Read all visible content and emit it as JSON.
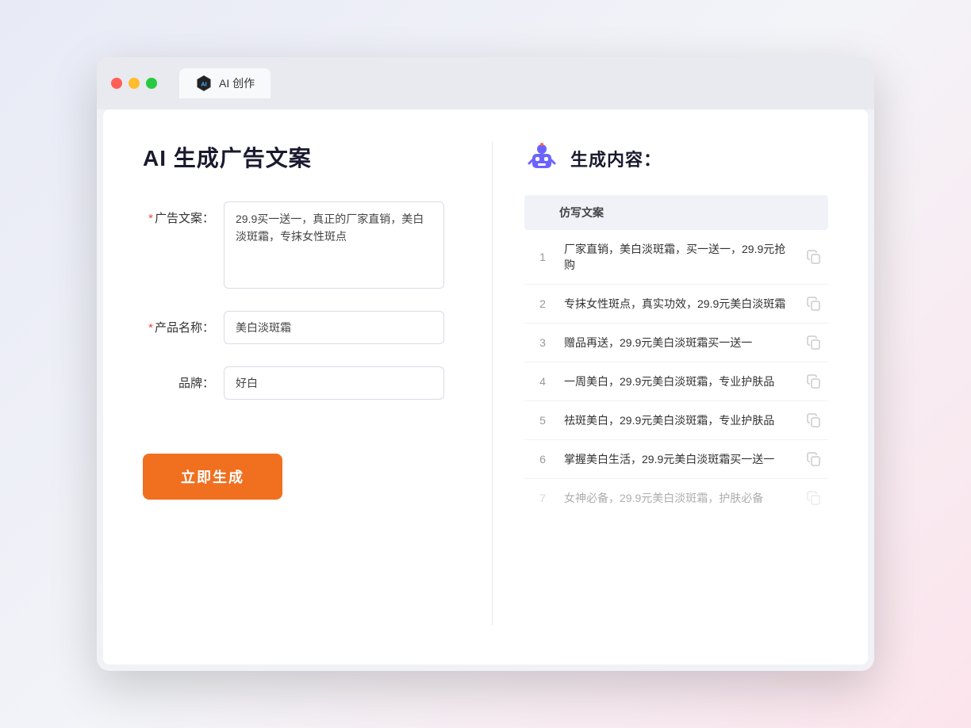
{
  "browser": {
    "tab_title": "AI 创作"
  },
  "page": {
    "title": "AI 生成广告文案",
    "result_title": "生成内容："
  },
  "form": {
    "ad_copy_label": "广告文案：",
    "ad_copy_required": "*",
    "ad_copy_value": "29.9买一送一，真正的厂家直销，美白淡斑霜，专抹女性斑点",
    "product_name_label": "产品名称：",
    "product_name_required": "*",
    "product_name_value": "美白淡斑霜",
    "brand_label": "品牌：",
    "brand_value": "好白",
    "generate_button": "立即生成"
  },
  "results": {
    "column_header": "仿写文案",
    "items": [
      {
        "id": 1,
        "text": "厂家直销，美白淡斑霜，买一送一，29.9元抢购",
        "faded": false
      },
      {
        "id": 2,
        "text": "专抹女性斑点，真实功效，29.9元美白淡斑霜",
        "faded": false
      },
      {
        "id": 3,
        "text": "赠品再送，29.9元美白淡斑霜买一送一",
        "faded": false
      },
      {
        "id": 4,
        "text": "一周美白，29.9元美白淡斑霜，专业护肤品",
        "faded": false
      },
      {
        "id": 5,
        "text": "祛斑美白，29.9元美白淡斑霜，专业护肤品",
        "faded": false
      },
      {
        "id": 6,
        "text": "掌握美白生活，29.9元美白淡斑霜买一送一",
        "faded": false
      },
      {
        "id": 7,
        "text": "女神必备，29.9元美白淡斑霜，护肤必备",
        "faded": true
      }
    ]
  }
}
